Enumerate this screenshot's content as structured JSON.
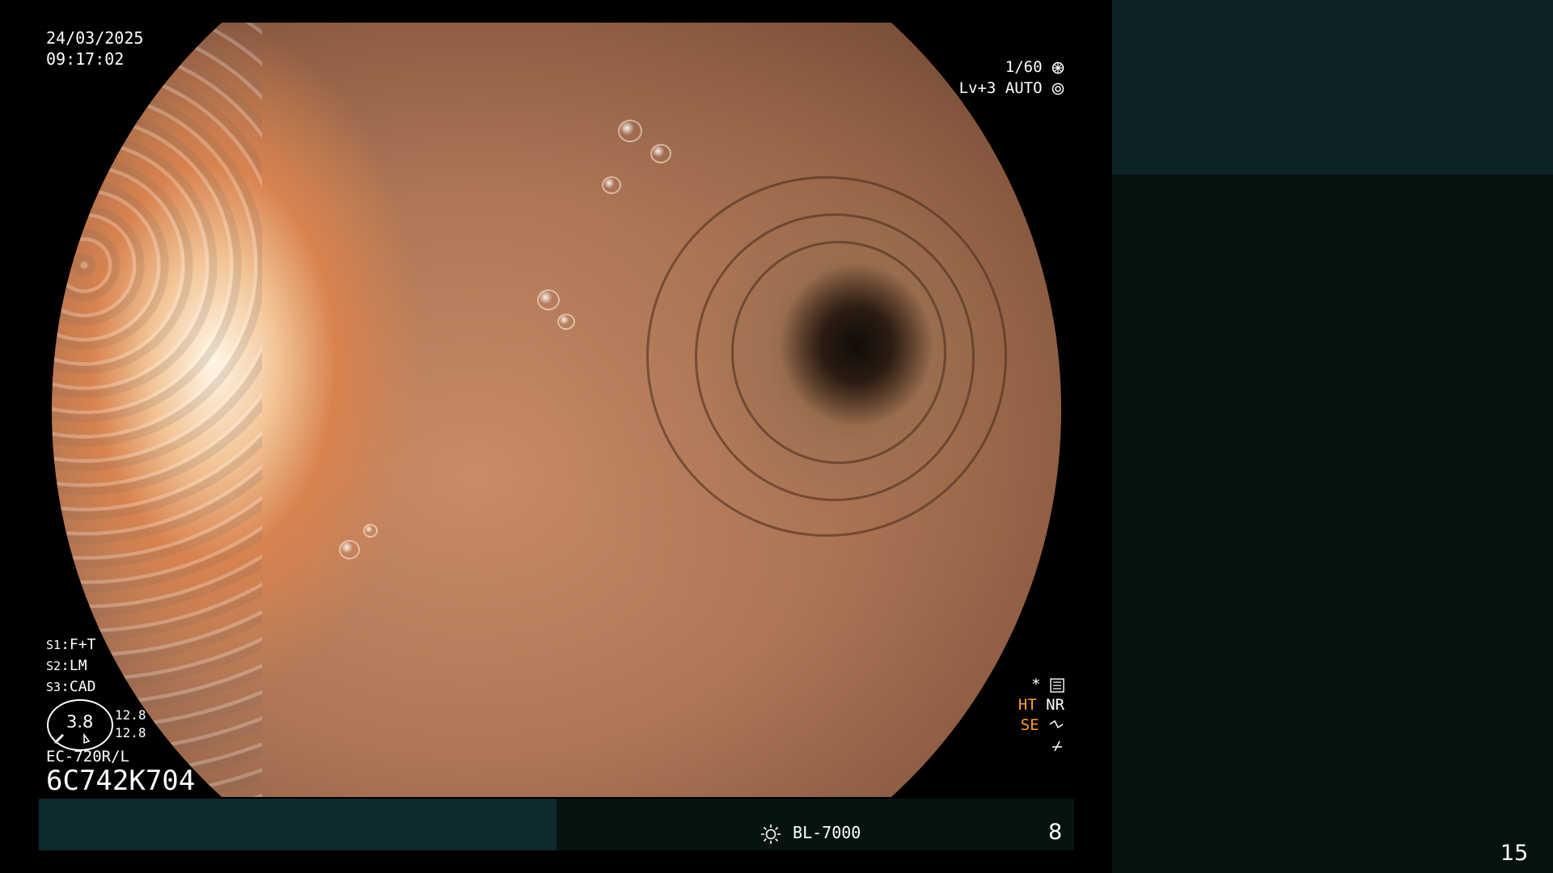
{
  "overlay": {
    "date": "24/03/2025",
    "time": "09:17:02",
    "shutter": "1/60",
    "level_auto": "Lv+3 AUTO",
    "switches": [
      {
        "key": "S1",
        "value": "F+T"
      },
      {
        "key": "S2",
        "value": "LM"
      },
      {
        "key": "S3",
        "value": "CAD"
      }
    ],
    "gauge_value": "3.8",
    "gauge_side_top": "12.8",
    "gauge_side_bottom": "12.8",
    "scope_model": "EC-720R/L",
    "serial": "6C742K704",
    "mode_ht": "HT",
    "mode_nr": "NR",
    "mode_se": "SE"
  },
  "bottom_bar": {
    "lamp_label": "BL-7000",
    "number": "8"
  },
  "page_number": "15",
  "colors": {
    "background": "#000000",
    "bar_left": "#0f2a2c",
    "bar_mid": "#061411",
    "side_top": "#0d2224",
    "side_bottom": "#061210",
    "accent_orange": "#ff9e2c"
  }
}
